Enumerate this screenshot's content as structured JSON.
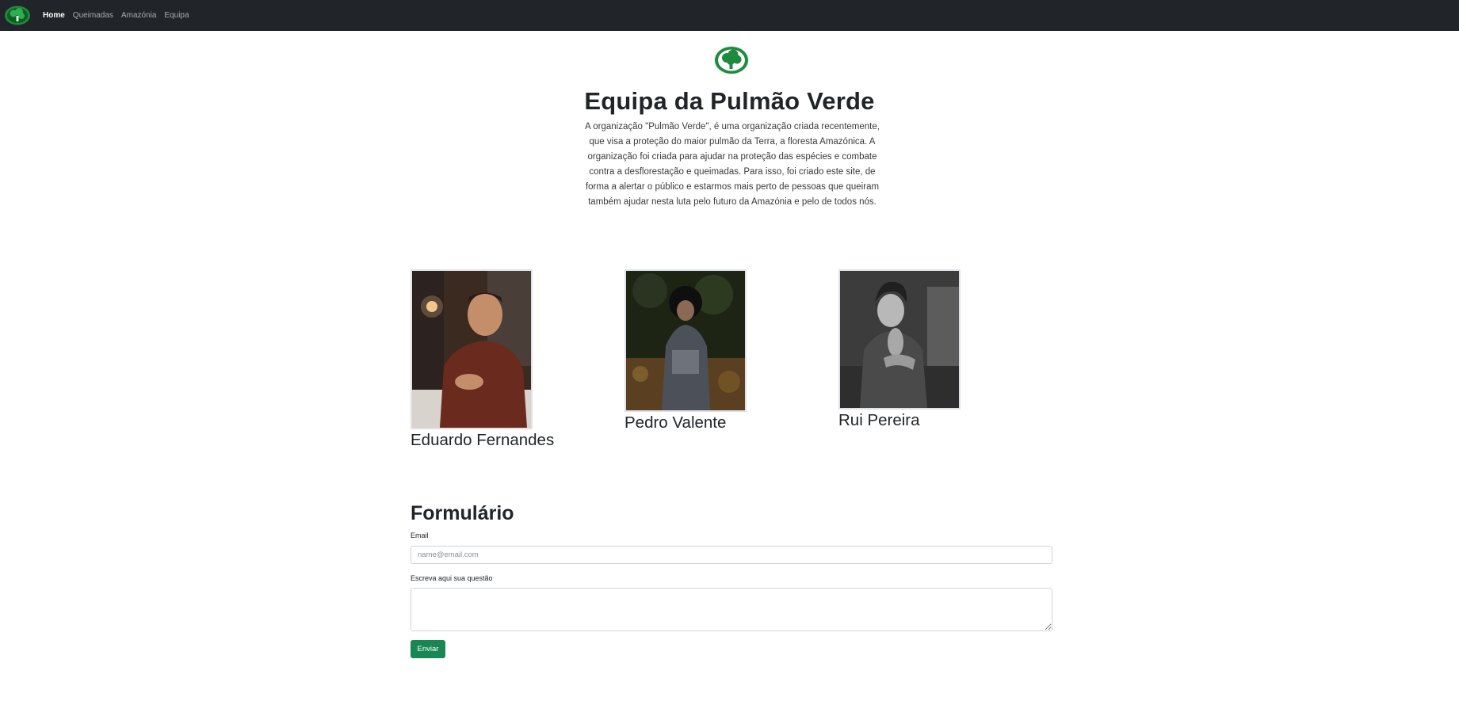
{
  "navbar": {
    "logo_icon": "tree-logo-icon",
    "links": [
      {
        "label": "Home",
        "active": true
      },
      {
        "label": "Queimadas",
        "active": false
      },
      {
        "label": "Amazónia",
        "active": false
      },
      {
        "label": "Equipa",
        "active": false
      }
    ]
  },
  "header": {
    "logo_icon": "tree-logo-icon",
    "title": "Equipa da Pulmão Verde",
    "intro": "A organização \"Pulmão Verde\", é uma organização criada recentemente, que visa a proteção do maior pulmão da Terra, a floresta Amazónica. A organização foi criada para ajudar na proteção das espécies e combate contra a desflorestação e queimadas. Para isso, foi criado este site, de forma a alertar o público e estarmos mais perto de pessoas que queiram também ajudar nesta luta pelo futuro da Amazónia e pelo de todos nós."
  },
  "team": [
    {
      "name": "Eduardo Fernandes"
    },
    {
      "name": "Pedro Valente"
    },
    {
      "name": "Rui Pereira"
    }
  ],
  "form": {
    "title": "Formulário",
    "email_label": "Email",
    "email_placeholder": "name@email.com",
    "email_value": "",
    "question_label": "Escreva aqui sua questão",
    "question_value": "",
    "submit_label": "Enviar"
  },
  "colors": {
    "navbar_bg": "#212529",
    "brand_green": "#1e8a3e",
    "button_green": "#198754"
  }
}
